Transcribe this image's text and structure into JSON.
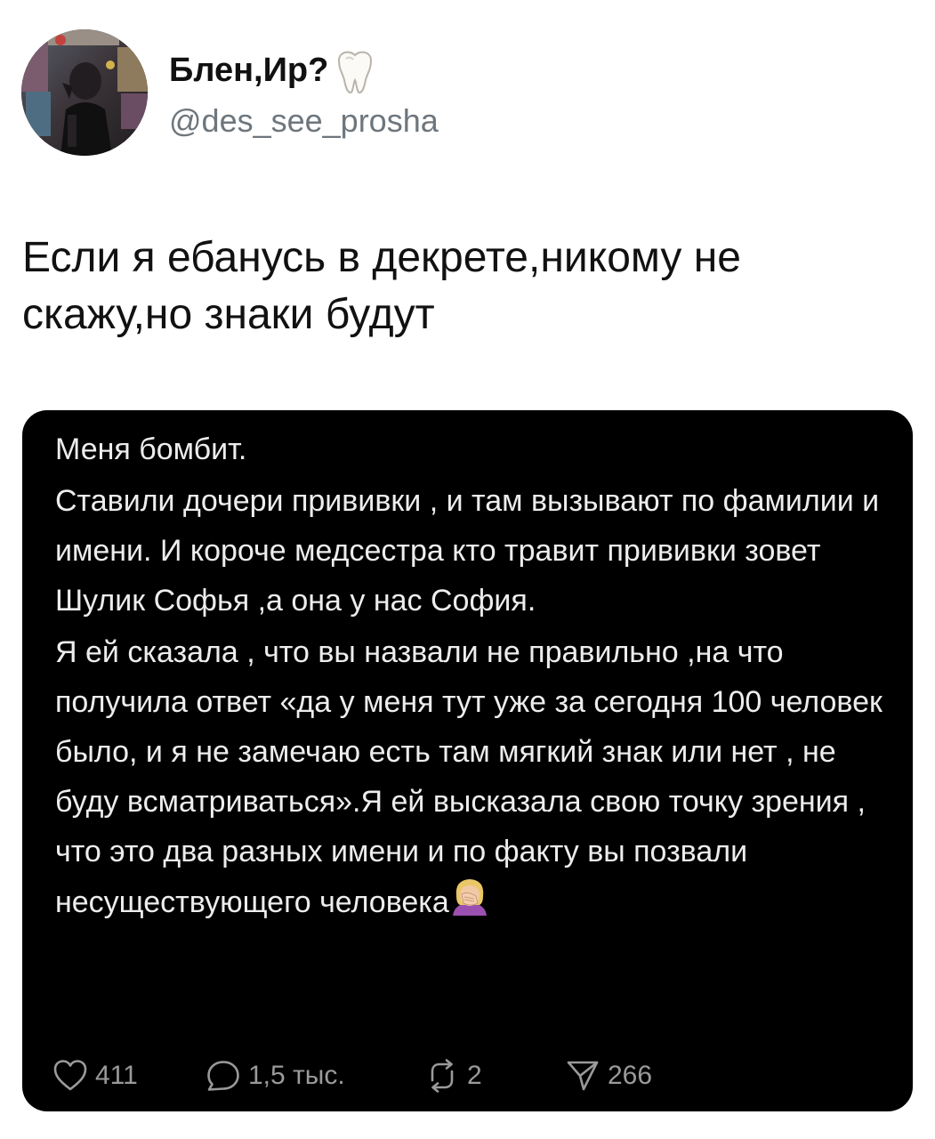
{
  "author": {
    "display_name": "Блен,Ир?",
    "handle": "@des_see_prosha",
    "name_icon": "tooth-icon",
    "avatar": "user-avatar-photo"
  },
  "tweet": {
    "text": "Если я ебанусь в декрете,никому не скажу,но знаки будут"
  },
  "embedded_post": {
    "paragraphs": [
      "Меня бомбит.",
      "Ставили дочери прививки , и там вызывают по фамилии и имени. И короче медсестра кто травит прививки зовет Шулик Софья ,а она у нас София.",
      "Я ей сказала , что вы назвали не правильно ,на что получила ответ «да у меня тут уже за сегодня 100 человек было, и я не замечаю есть там мягкий знак или нет , не буду всматриваться».Я ей высказала свою точку зрения , что это два разных имени и по факту вы позвали несуществующего человека"
    ],
    "trailing_emoji": "woman-facepalming-emoji",
    "stats": {
      "likes": "411",
      "comments": "1,5 тыс.",
      "reposts": "2",
      "shares": "266"
    },
    "colors": {
      "card_background": "#000000",
      "text": "#ededed",
      "stats": "#9a9a9a"
    }
  }
}
